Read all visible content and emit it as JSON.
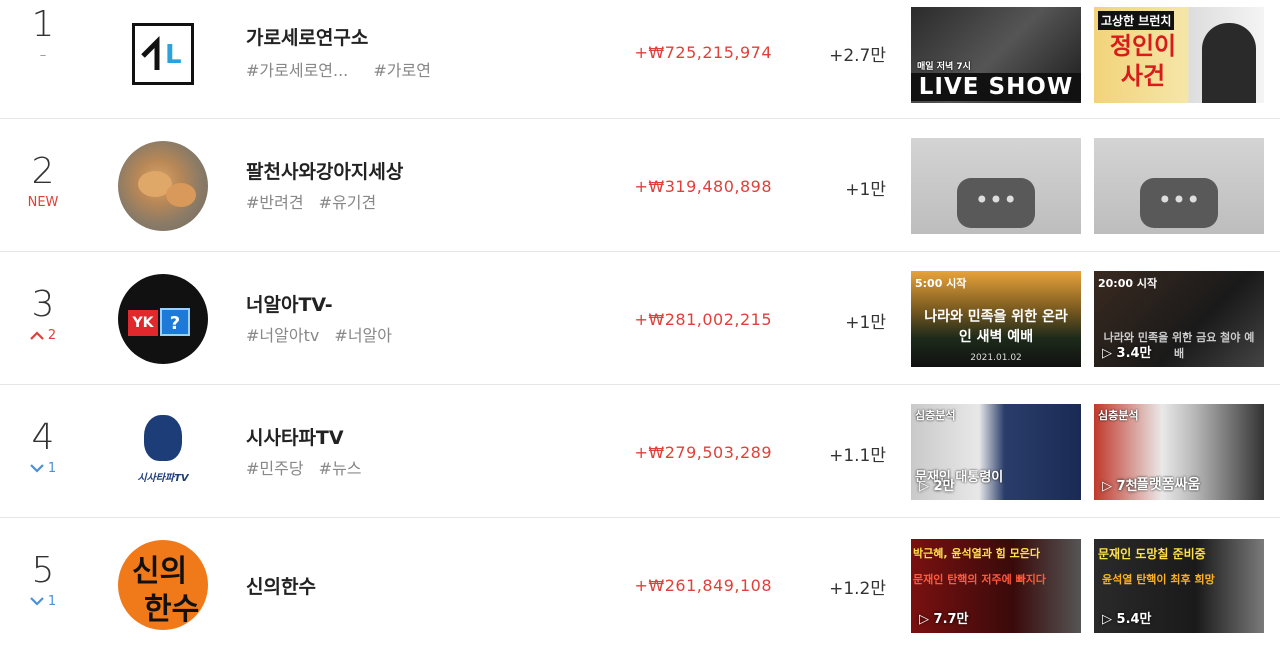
{
  "rows": [
    {
      "rank": "1",
      "change": "–",
      "name": "가로세로연구소",
      "tags": [
        "#가로세로연...",
        "#가로연"
      ],
      "money": "+₩725,215,974",
      "subs": "+2.7만",
      "thumbs": [
        {
          "top": "매일 저녁 7시",
          "main": "LIVE SHOW",
          "views": ""
        },
        {
          "top": "고상한 브런치",
          "main": "정인이 사건",
          "views": ""
        }
      ]
    },
    {
      "rank": "2",
      "change": "NEW",
      "name": "팔천사와강아지세상",
      "tags": [
        "#반려견",
        "#유기견"
      ],
      "money": "+₩319,480,898",
      "subs": "+1만",
      "thumbs": [
        {
          "top": "",
          "main": "",
          "views": ""
        },
        {
          "top": "",
          "main": "",
          "views": ""
        }
      ]
    },
    {
      "rank": "3",
      "change": "2",
      "name": "너알아TV-",
      "tags": [
        "#너알아tv",
        "#너알아"
      ],
      "money": "+₩281,002,215",
      "subs": "+1만",
      "thumbs": [
        {
          "top": "5:00 시작",
          "main": "나라와 민족을 위한 온라인 새벽 예배",
          "views": "",
          "date": "2021.01.02"
        },
        {
          "top": "20:00 시작",
          "main": "나라와 민족을 위한 금요 철야 예배",
          "views": "3.4만"
        }
      ]
    },
    {
      "rank": "4",
      "change": "1",
      "name": "시사타파TV",
      "tags": [
        "#민주당",
        "#뉴스"
      ],
      "money": "+₩279,503,289",
      "subs": "+1.1만",
      "thumbs": [
        {
          "top": "심층분석",
          "main": "문재인 대통령이",
          "views": "2만"
        },
        {
          "top": "심층분석",
          "main": "플랫폼싸움",
          "views": "7천"
        }
      ]
    },
    {
      "rank": "5",
      "change": "1",
      "name": "신의한수",
      "tags": [],
      "money": "+₩261,849,108",
      "subs": "+1.2만",
      "thumbs": [
        {
          "top": "박근혜, 윤석열과 힘 모은다",
          "main": "문재인 탄핵의 저주에 빠지다",
          "views": "7.7만"
        },
        {
          "top": "문재인 도망칠 준비중",
          "main": "윤석열 탄핵이 최후 희망",
          "views": "5.4만"
        }
      ]
    }
  ],
  "avatars": {
    "r1": "L",
    "r3a": "YK",
    "r3b": "?",
    "r4": "시사타파TV",
    "r5a": "신의",
    "r5b": "한수"
  },
  "colors": {
    "red": "#e0403a",
    "blue": "#4a90d9"
  }
}
